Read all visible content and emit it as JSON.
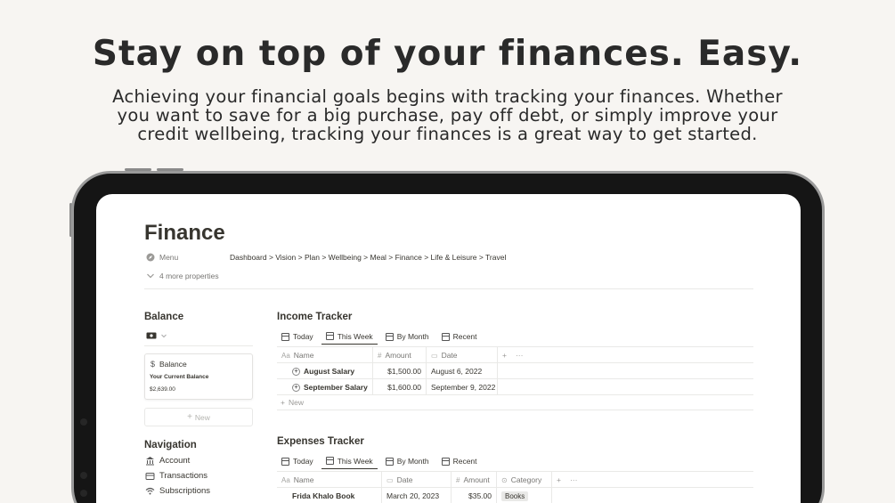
{
  "hero": {
    "title": "Stay on top of your finances. Easy.",
    "subtitle": "Achieving your financial goals begins with tracking your finances. Whether you want to save for a big purchase, pay off debt, or simply improve your credit wellbeing, tracking your finances is a great way to get started."
  },
  "page": {
    "title": "Finance",
    "menu_label": "Menu",
    "breadcrumb": "Dashboard > Vision > Plan > Wellbeing > Meal > Finance > Life & Leisure > Travel",
    "more_properties": "4 more properties"
  },
  "balance": {
    "section_title": "Balance",
    "card_title": "Balance",
    "card_label": "Your Current Balance",
    "card_value": "$2,639.00",
    "new_label": "New"
  },
  "navigation": {
    "section_title": "Navigation",
    "items": [
      {
        "label": "Account",
        "icon": "bank-icon"
      },
      {
        "label": "Transactions",
        "icon": "wallet-icon"
      },
      {
        "label": "Subscriptions",
        "icon": "wifi-icon"
      }
    ]
  },
  "income": {
    "title": "Income Tracker",
    "tabs": [
      "Today",
      "This Week",
      "By Month",
      "Recent"
    ],
    "active_tab": "This Week",
    "columns": [
      "Name",
      "Amount",
      "Date"
    ],
    "rows": [
      {
        "name": "August Salary",
        "amount": "$1,500.00",
        "date": "August 6, 2022"
      },
      {
        "name": "September Salary",
        "amount": "$1,600.00",
        "date": "September 9, 2022"
      }
    ],
    "new_label": "New"
  },
  "expenses": {
    "title": "Expenses Tracker",
    "tabs": [
      "Today",
      "This Week",
      "By Month",
      "Recent"
    ],
    "active_tab": "This Week",
    "columns": [
      "Name",
      "Date",
      "Amount",
      "Category"
    ],
    "rows": [
      {
        "name": "Frida Khalo Book",
        "date": "March 20, 2023",
        "amount": "$35.00",
        "category": "Books"
      }
    ]
  },
  "colors": {
    "background": "#f7f5f2",
    "text": "#37352f",
    "muted": "#787774",
    "device_frame": "#151515"
  }
}
